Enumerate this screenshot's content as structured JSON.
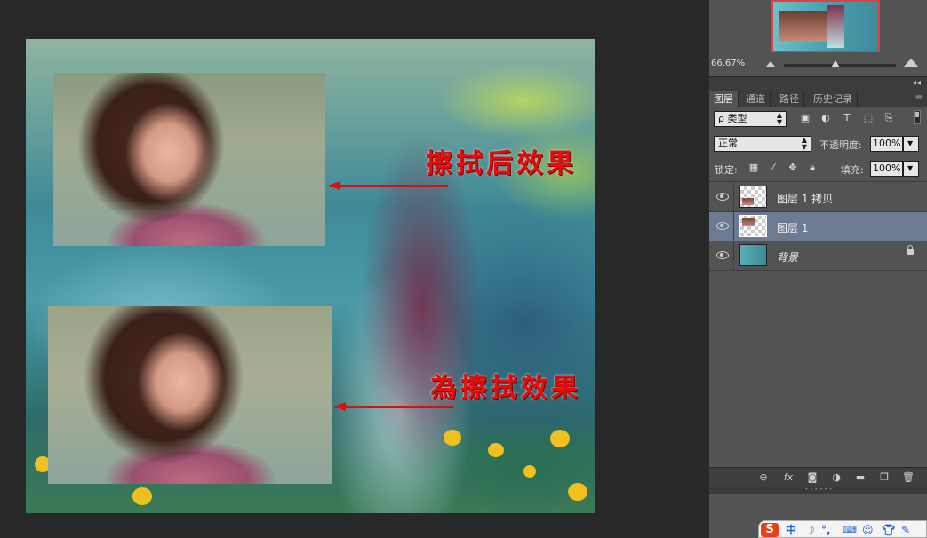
{
  "canvas": {
    "annotation_top": "擦拭后效果",
    "annotation_bottom": "為擦拭效果"
  },
  "navigator": {
    "zoom": "66.67%",
    "zoom_slider_fraction": 0.46
  },
  "panel_tabs": [
    "图层",
    "通道",
    "路径",
    "历史记录"
  ],
  "filter": {
    "kind_label": "ρ 类型"
  },
  "blend": {
    "mode": "正常",
    "opacity_label": "不透明度:",
    "opacity_value": "100%"
  },
  "lock": {
    "label": "锁定:",
    "fill_label": "填充:",
    "fill_value": "100%"
  },
  "layers": [
    {
      "name": "图层 1 拷贝",
      "selected": false
    },
    {
      "name": "图层 1",
      "selected": true
    },
    {
      "name": "背景",
      "selected": false,
      "locked": true
    }
  ],
  "ime": {
    "logo": "S",
    "lang": "中"
  },
  "colors": {
    "annotation": "#e01010",
    "selected_layer": "#6c7a92",
    "panel_bg": "#535353",
    "workspace_bg": "#282828"
  }
}
